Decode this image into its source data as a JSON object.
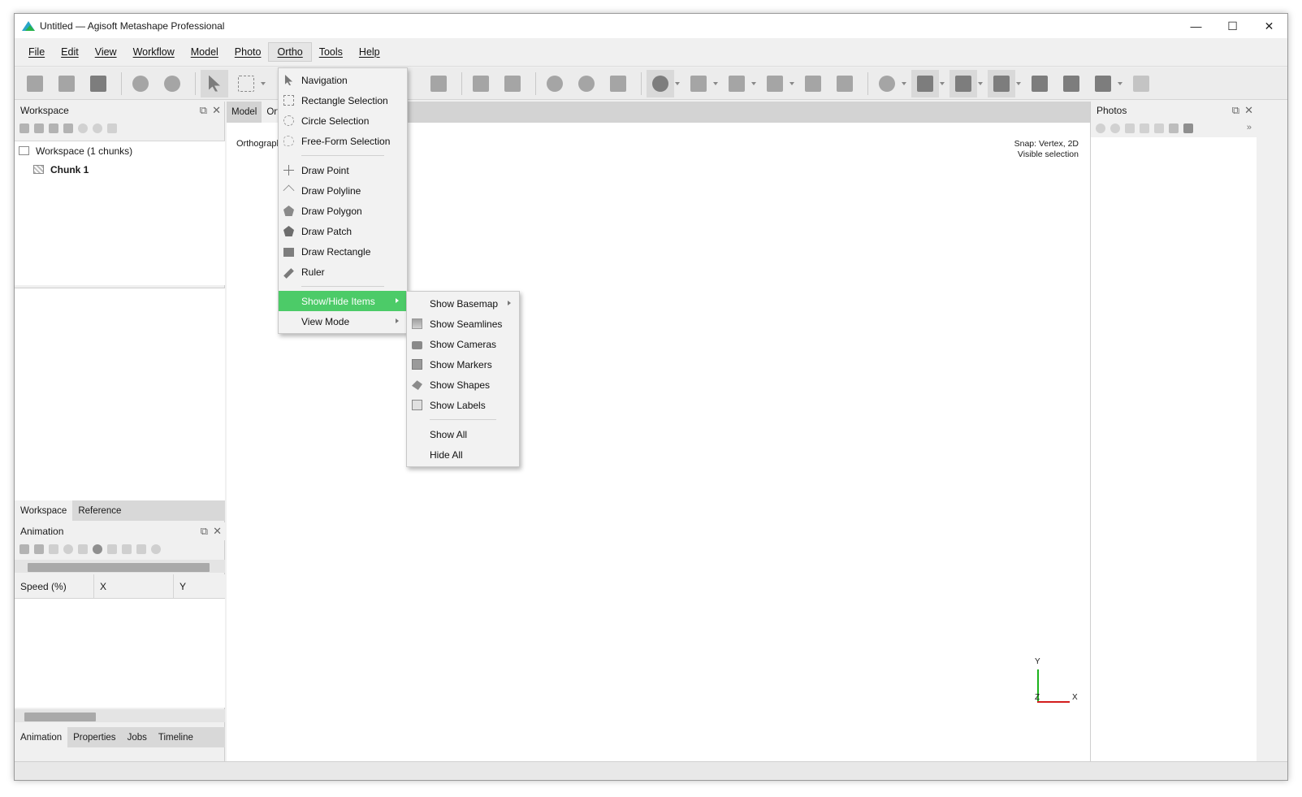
{
  "window": {
    "title": "Untitled — Agisoft Metashape Professional",
    "controls": {
      "minimize": "—",
      "maximize": "☐",
      "close": "✕"
    }
  },
  "menubar": {
    "items": [
      "File",
      "Edit",
      "View",
      "Workflow",
      "Model",
      "Photo",
      "Ortho",
      "Tools",
      "Help"
    ],
    "active": "Ortho"
  },
  "workspace_panel": {
    "title": "Workspace",
    "tree": {
      "root": "Workspace (1 chunks)",
      "chunk": "Chunk 1"
    },
    "tabs": [
      "Workspace",
      "Reference"
    ]
  },
  "animation_panel": {
    "title": "Animation",
    "columns": [
      "Speed (%)",
      "X",
      "Y"
    ],
    "tabs": [
      "Animation",
      "Properties",
      "Jobs",
      "Timeline"
    ]
  },
  "view": {
    "tabs": [
      "Model",
      "Ortho"
    ],
    "mode_label": "Orthographic",
    "snap_info": [
      "Snap: Vertex, 2D",
      "Visible selection"
    ],
    "axes": {
      "y": "Y",
      "x": "X",
      "z": "Z"
    }
  },
  "photos_panel": {
    "title": "Photos",
    "more": "»"
  },
  "ortho_menu": {
    "items": [
      {
        "label": "Navigation",
        "icon": "cursor-icon"
      },
      {
        "label": "Rectangle Selection",
        "icon": "rectangle-selection-icon"
      },
      {
        "label": "Circle Selection",
        "icon": "circle-selection-icon"
      },
      {
        "label": "Free-Form Selection",
        "icon": "freeform-selection-icon"
      },
      {
        "label": "Draw Point",
        "icon": "draw-point-icon"
      },
      {
        "label": "Draw Polyline",
        "icon": "draw-polyline-icon"
      },
      {
        "label": "Draw Polygon",
        "icon": "draw-polygon-icon"
      },
      {
        "label": "Draw Patch",
        "icon": "draw-patch-icon"
      },
      {
        "label": "Draw Rectangle",
        "icon": "draw-rectangle-icon"
      },
      {
        "label": "Ruler",
        "icon": "ruler-icon"
      },
      {
        "label": "Show/Hide Items"
      },
      {
        "label": "View Mode"
      }
    ]
  },
  "showhide_submenu": {
    "items": [
      {
        "label": "Show Basemap",
        "icon": "basemap-icon"
      },
      {
        "label": "Show Seamlines",
        "icon": "seamlines-icon"
      },
      {
        "label": "Show Cameras",
        "icon": "camera-icon"
      },
      {
        "label": "Show Markers",
        "icon": "marker-flag-icon"
      },
      {
        "label": "Show Shapes",
        "icon": "shapes-icon"
      },
      {
        "label": "Show Labels",
        "icon": "labels-icon"
      },
      {
        "label": "Show All"
      },
      {
        "label": "Hide All"
      }
    ]
  },
  "colors": {
    "highlight": "#4ccb68",
    "axis_x": "#d31e1e",
    "axis_y": "#1db31d"
  }
}
